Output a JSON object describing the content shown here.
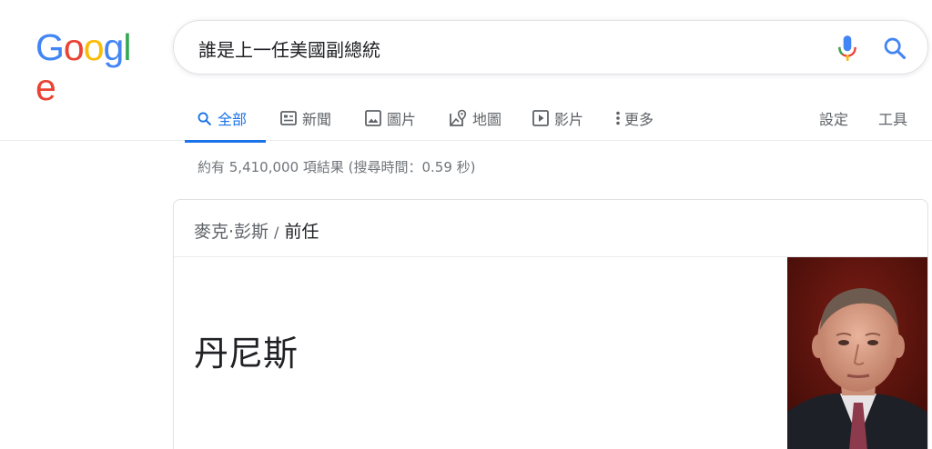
{
  "logo": {
    "letters": [
      "G",
      "o",
      "o",
      "g",
      "l",
      "e"
    ],
    "colors": [
      "#4285F4",
      "#EA4335",
      "#FBBC05",
      "#4285F4",
      "#34A853",
      "#EA4335"
    ]
  },
  "search": {
    "query": "誰是上一任美國副總統",
    "icons": [
      "mic-icon",
      "search-icon"
    ]
  },
  "tabs": [
    {
      "label": "全部",
      "icon": "search-icon",
      "active": true
    },
    {
      "label": "新聞",
      "icon": "news-icon"
    },
    {
      "label": "圖片",
      "icon": "image-icon"
    },
    {
      "label": "地圖",
      "icon": "map-icon"
    },
    {
      "label": "影片",
      "icon": "video-icon"
    },
    {
      "label": "更多",
      "icon": "more-vert-icon"
    }
  ],
  "tools": {
    "settings": "設定",
    "tools": "工具"
  },
  "stats": "約有 5,410,000 項結果 (搜尋時間：0.59 秒)",
  "card": {
    "subject": "麥克·彭斯",
    "separator": "/",
    "relation": "前任",
    "answer": "丹尼斯"
  },
  "colors": {
    "accent": "#1a73e8",
    "text": "#202124",
    "muted": "#5f6368",
    "stats": "#70757a"
  }
}
